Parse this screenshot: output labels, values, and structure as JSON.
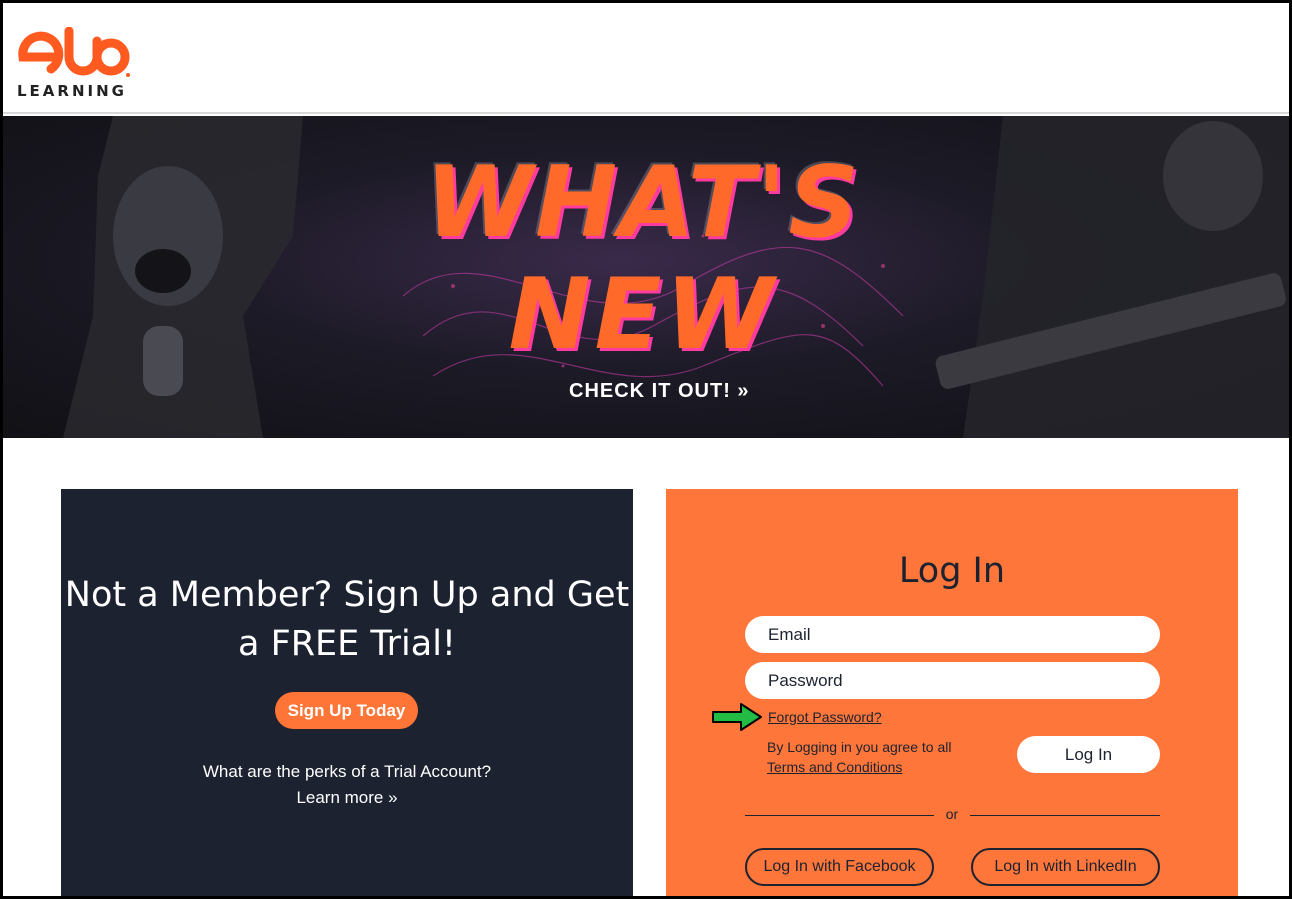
{
  "brand": {
    "logo_word": "LEARNING",
    "logo_icon": "elb-logo-mark",
    "accent_color": "#ff5a1f"
  },
  "hero": {
    "line1": "WHAT'S",
    "line2": "NEW",
    "cta": "CHECK IT OUT! »"
  },
  "signup": {
    "heading": "Not a Member? Sign Up and Get a FREE Trial!",
    "button_label": "Sign Up Today",
    "perks_question": "What are the perks of a Trial Account?",
    "learn_more": "Learn more »"
  },
  "login": {
    "title": "Log In",
    "email_placeholder": "Email",
    "password_placeholder": "Password",
    "forgot_password": "Forgot Password?",
    "agree_text": "By Logging in you agree to all",
    "terms_link": "Terms and Conditions",
    "login_button": "Log In",
    "or_text": "or",
    "facebook_button": "Log In with Facebook",
    "linkedin_button": "Log In with LinkedIn",
    "annotation_arrow_color": "#22bb44"
  }
}
